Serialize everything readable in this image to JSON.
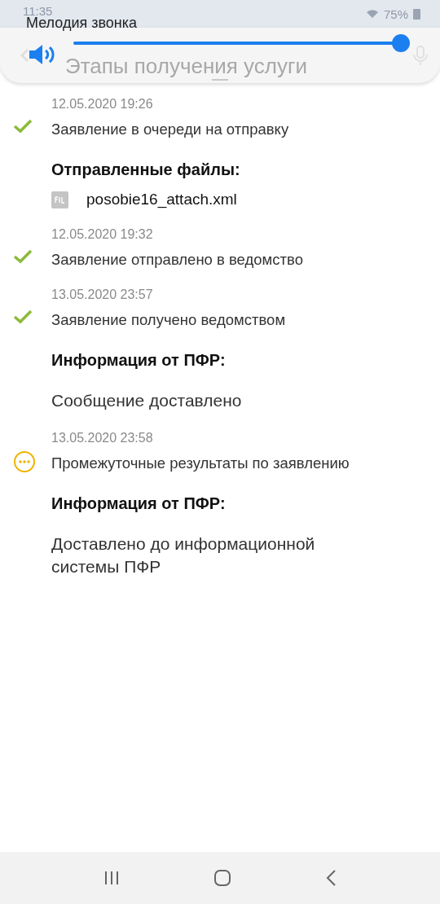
{
  "status_bar": {
    "time": "11:35",
    "battery": "75%"
  },
  "app_bar": {
    "title": "Этапы получения услуги"
  },
  "volume_panel": {
    "label": "Мелодия звонка",
    "level": 1.0
  },
  "stages": [
    {
      "time": "12.05.2020 19:26",
      "kind": "done",
      "title": "Заявление в очереди на отправку",
      "sections": [
        {
          "kind": "files",
          "heading": "Отправленные файлы:",
          "files": [
            "posobie16_attach.xml"
          ]
        }
      ]
    },
    {
      "time": "12.05.2020 19:32",
      "kind": "done",
      "title": "Заявление отправлено в ведомство"
    },
    {
      "time": "13.05.2020 23:57",
      "kind": "done",
      "title": "Заявление получено ведомством",
      "sections": [
        {
          "kind": "info",
          "heading": "Информация от ПФР:",
          "message": "Сообщение доставлено"
        }
      ]
    },
    {
      "time": "13.05.2020 23:58",
      "kind": "pending",
      "title": "Промежуточные результаты по заявлению",
      "sections": [
        {
          "kind": "info",
          "heading": "Информация от ПФР:",
          "message": "Доставлено до информационной системы ПФР"
        }
      ]
    }
  ]
}
